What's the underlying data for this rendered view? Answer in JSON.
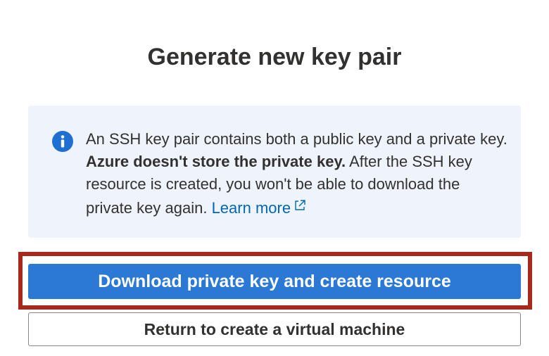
{
  "dialog": {
    "title": "Generate new key pair"
  },
  "info": {
    "icon": "info-icon",
    "text_part1": "An SSH key pair contains both a public key and a private key.",
    "text_bold": "Azure doesn't store the private key.",
    "text_part2": "After the SSH key resource is created, you won't be able to download the private key again.",
    "learn_more_label": "Learn more",
    "learn_more_icon": "external-link-icon"
  },
  "actions": {
    "primary_label": "Download private key and create resource",
    "secondary_label": "Return to create a virtual machine"
  },
  "colors": {
    "primary": "#2b79d4",
    "info_background": "#eff4fc",
    "link": "#0067b8",
    "highlight_border": "#a52a1c"
  }
}
